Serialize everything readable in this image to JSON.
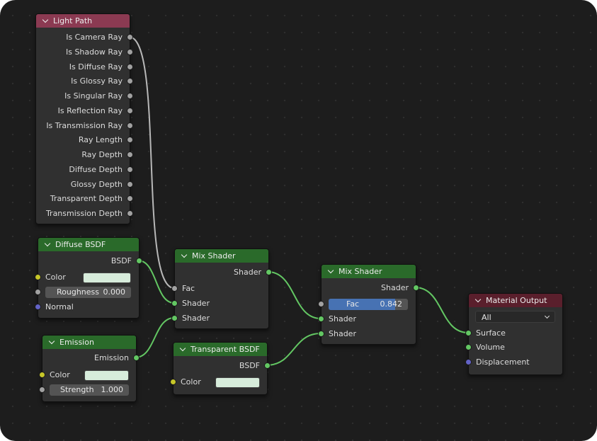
{
  "nodes": {
    "light_path": {
      "title": "Light Path",
      "outputs": [
        "Is Camera Ray",
        "Is Shadow Ray",
        "Is Diffuse Ray",
        "Is Glossy Ray",
        "Is Singular Ray",
        "Is Reflection Ray",
        "Is Transmission Ray",
        "Ray Length",
        "Ray Depth",
        "Diffuse Depth",
        "Glossy Depth",
        "Transparent Depth",
        "Transmission Depth"
      ]
    },
    "diffuse": {
      "title": "Diffuse BSDF",
      "output": "BSDF",
      "color_label": "Color",
      "roughness_label": "Roughness",
      "roughness_value": "0.000",
      "normal_label": "Normal"
    },
    "emission": {
      "title": "Emission",
      "output": "Emission",
      "color_label": "Color",
      "strength_label": "Strength",
      "strength_value": "1.000"
    },
    "mix1": {
      "title": "Mix Shader",
      "output": "Shader",
      "fac_label": "Fac",
      "shader1": "Shader",
      "shader2": "Shader"
    },
    "transparent": {
      "title": "Transparent BSDF",
      "output": "BSDF",
      "color_label": "Color"
    },
    "mix2": {
      "title": "Mix Shader",
      "output": "Shader",
      "fac_label": "Fac",
      "fac_value": "0.842",
      "fac_fraction": 0.842,
      "shader1": "Shader",
      "shader2": "Shader"
    },
    "output": {
      "title": "Material Output",
      "target": "All",
      "surface": "Surface",
      "volume": "Volume",
      "displacement": "Displacement"
    }
  },
  "colors": {
    "input_header": "#8b3a52",
    "shader_header": "#2a6a2a",
    "output_header": "#5a1f2c",
    "shader_link": "#63c763",
    "float_link": "#b8b8b8",
    "swatch": "#d7ecdb",
    "slider_fill": "#4772b3"
  }
}
